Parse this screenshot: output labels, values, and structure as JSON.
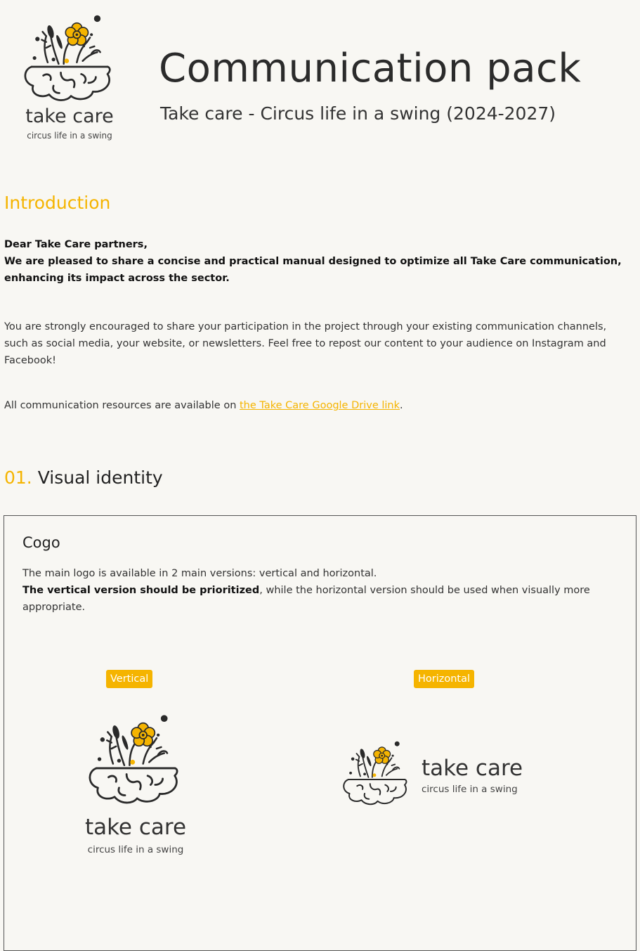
{
  "header": {
    "brand_name": "take care",
    "brand_tagline": "circus life in a swing",
    "title": "Communication pack",
    "subtitle": "Take care - Circus life in a swing (2024-2027)"
  },
  "intro": {
    "heading": "Introduction",
    "greeting_line1": "Dear Take Care partners,",
    "greeting_line2": "We are pleased to share a concise and practical manual designed to optimize all Take Care communication, enhancing its impact across the sector.",
    "paragraph1": "You are strongly encouraged to share your participation in the project through your existing communication channels, such as social media, your website, or newsletters. Feel free to repost our content to your audience on Instagram and Facebook!",
    "paragraph2_prefix": "All communication resources are available on ",
    "paragraph2_link": "the Take Care Google Drive link",
    "paragraph2_suffix": "."
  },
  "visual_identity": {
    "number": "01.",
    "heading": "Visual identity",
    "logo_panel": {
      "title": "Cogo",
      "line1": "The main logo is available in 2 main versions: vertical and horizontal.",
      "line2_bold": "The vertical version should be prioritized",
      "line2_rest": ", while the horizontal version should be used when visually more appropriate.",
      "vertical_label": "Vertical",
      "horizontal_label": "Horizontal"
    }
  },
  "colors": {
    "accent": "#f5b400",
    "text": "#222222",
    "background": "#f8f7f3"
  }
}
